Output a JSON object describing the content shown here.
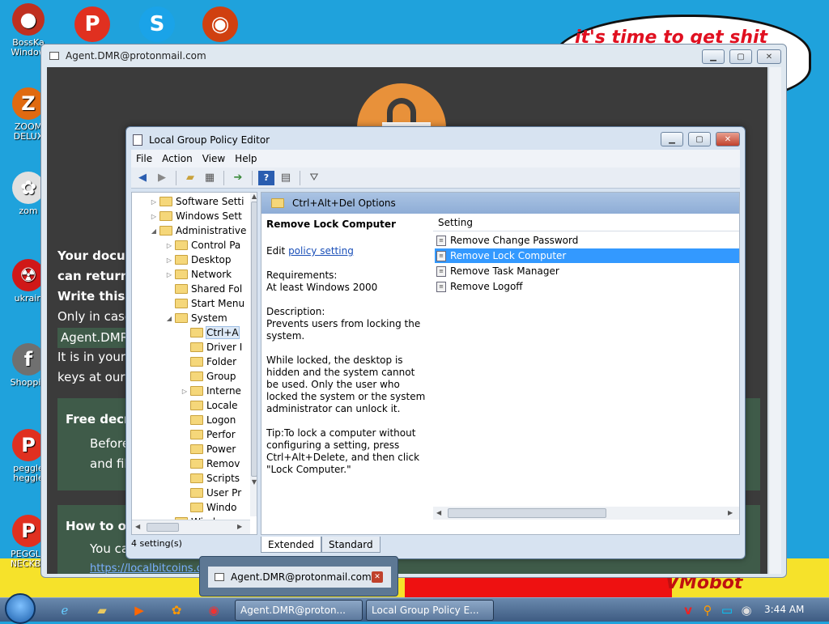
{
  "desktop": {
    "wallpaper_text": "it's time to get shit",
    "wallpaper_logo": "VMobot",
    "icons": [
      {
        "label": "BossKa Window",
        "icon": "robot-icon",
        "color": "#c03020",
        "glyph": "●"
      },
      {
        "label": "ZOOM DELUX",
        "icon": "zoom-game-icon",
        "color": "#e06a10",
        "glyph": "Z"
      },
      {
        "label": "zom",
        "icon": "flower-icon",
        "color": "#e0e0e0",
        "glyph": "✿"
      },
      {
        "label": "ukrain",
        "icon": "radiation-icon",
        "color": "#d01818",
        "glyph": "☢"
      },
      {
        "label": "Shoppin",
        "icon": "flash-icon",
        "color": "#707070",
        "glyph": "f"
      },
      {
        "label": "peggle heggle",
        "icon": "peggle-icon",
        "color": "#e03020",
        "glyph": "P"
      },
      {
        "label": "PEGGLE NECKBE",
        "icon": "peggle-icon",
        "color": "#e03020",
        "glyph": "P"
      }
    ],
    "top_icons": [
      {
        "icon": "peggle-icon",
        "color": "#e03020",
        "glyph": "P"
      },
      {
        "icon": "skype-icon",
        "color": "#1aa3e8",
        "glyph": "S"
      },
      {
        "icon": "globe-icon",
        "color": "#d04010",
        "glyph": "◉"
      }
    ]
  },
  "ransom_window": {
    "title": "Agent.DMR@protonmail.com",
    "lines": [
      "Your docum",
      "can return a",
      "Write this I",
      "Only in case",
      "Agent.DMR@",
      "It is in your in",
      "keys at our s"
    ],
    "box1_title": "Free decry",
    "box1_lines": [
      "Before",
      "and fil"
    ],
    "box2_title": "How to ob",
    "box2_lines": [
      "You ca"
    ],
    "link": "https://localbitcoins.co"
  },
  "gpe": {
    "title": "Local Group Policy Editor",
    "menu": [
      "File",
      "Action",
      "View",
      "Help"
    ],
    "tree": [
      {
        "label": "Software Setti",
        "indent": 0,
        "twisty": "▷"
      },
      {
        "label": "Windows Sett",
        "indent": 0,
        "twisty": "▷"
      },
      {
        "label": "Administrative",
        "indent": 0,
        "twisty": "◢"
      },
      {
        "label": "Control Pa",
        "indent": 1,
        "twisty": "▷"
      },
      {
        "label": "Desktop",
        "indent": 1,
        "twisty": "▷"
      },
      {
        "label": "Network",
        "indent": 1,
        "twisty": "▷"
      },
      {
        "label": "Shared Fol",
        "indent": 1,
        "twisty": ""
      },
      {
        "label": "Start Menu",
        "indent": 1,
        "twisty": ""
      },
      {
        "label": "System",
        "indent": 1,
        "twisty": "◢"
      },
      {
        "label": "Ctrl+A",
        "indent": 2,
        "twisty": "",
        "selected": true
      },
      {
        "label": "Driver I",
        "indent": 2,
        "twisty": ""
      },
      {
        "label": "Folder",
        "indent": 2,
        "twisty": ""
      },
      {
        "label": "Group",
        "indent": 2,
        "twisty": ""
      },
      {
        "label": "Interne",
        "indent": 2,
        "twisty": "▷"
      },
      {
        "label": "Locale",
        "indent": 2,
        "twisty": ""
      },
      {
        "label": "Logon",
        "indent": 2,
        "twisty": ""
      },
      {
        "label": "Perfor",
        "indent": 2,
        "twisty": ""
      },
      {
        "label": "Power",
        "indent": 2,
        "twisty": ""
      },
      {
        "label": "Remov",
        "indent": 2,
        "twisty": ""
      },
      {
        "label": "Scripts",
        "indent": 2,
        "twisty": ""
      },
      {
        "label": "User Pr",
        "indent": 2,
        "twisty": ""
      },
      {
        "label": "Windo",
        "indent": 2,
        "twisty": ""
      },
      {
        "label": "Windo",
        "indent": 1,
        "twisty": ""
      }
    ],
    "folder_header": "Ctrl+Alt+Del Options",
    "desc_title": "Remove Lock Computer",
    "edit_prefix": "Edit ",
    "edit_link": "policy setting",
    "req_label": "Requirements:",
    "req_value": "At least Windows 2000",
    "desc_label": "Description:",
    "desc_text": "Prevents users from locking the system.",
    "locked_text": "While locked, the desktop is hidden and the system cannot be used. Only the user who locked the system or the system administrator can unlock it.",
    "tip_text": "Tip:To lock a computer without configuring a setting, press Ctrl+Alt+Delete, and then click \"Lock Computer.\"",
    "column_header": "Setting",
    "settings": [
      {
        "label": "Remove Change Password",
        "selected": false
      },
      {
        "label": "Remove Lock Computer",
        "selected": true
      },
      {
        "label": "Remove Task Manager",
        "selected": false
      },
      {
        "label": "Remove Logoff",
        "selected": false
      }
    ],
    "tabs": [
      "Extended",
      "Standard"
    ],
    "status": "4 setting(s)"
  },
  "popup": {
    "title": "Agent.DMR@protonmail.com"
  },
  "taskbar": {
    "buttons": [
      "Agent.DMR@proton...",
      "Local Group Policy E..."
    ],
    "clock": "3:44 AM"
  }
}
